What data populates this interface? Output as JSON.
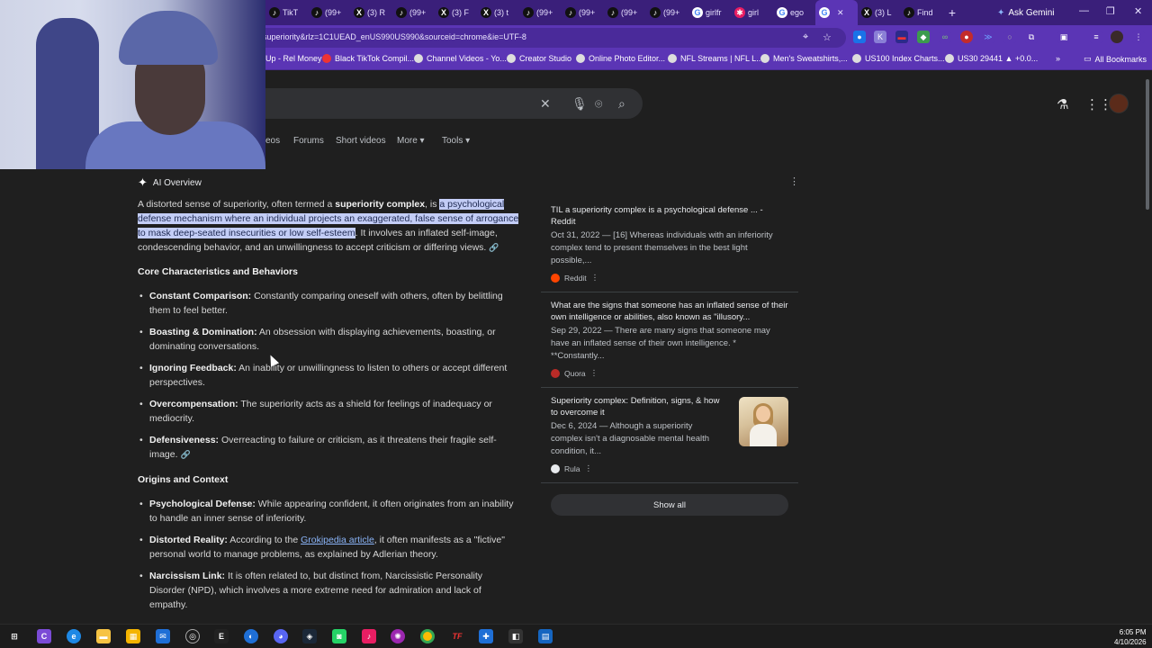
{
  "browser": {
    "tabs": [
      {
        "label": "TikT",
        "icon": "tiktok-icon"
      },
      {
        "label": "(99+",
        "icon": "tiktok-icon"
      },
      {
        "label": "(3) R",
        "icon": "x-icon"
      },
      {
        "label": "(99+",
        "icon": "tiktok-icon"
      },
      {
        "label": "(3) F",
        "icon": "x-icon"
      },
      {
        "label": "(3) t",
        "icon": "x-icon"
      },
      {
        "label": "(99+",
        "icon": "tiktok-icon"
      },
      {
        "label": "(99+",
        "icon": "tiktok-icon"
      },
      {
        "label": "(99+",
        "icon": "tiktok-icon"
      },
      {
        "label": "(99+",
        "icon": "tiktok-icon"
      },
      {
        "label": "girlfr",
        "icon": "google-icon"
      },
      {
        "label": "girl",
        "icon": "pinwheel-icon"
      },
      {
        "label": "ego",
        "icon": "google-icon"
      },
      {
        "label": "",
        "icon": "google-icon",
        "active": true
      },
      {
        "label": "(3) L",
        "icon": "x-icon"
      },
      {
        "label": "Find",
        "icon": "tiktok-icon"
      }
    ],
    "new_tab": "+",
    "gemini_label": "Ask Gemini",
    "url": "superiority&rlz=1C1UEAD_enUS990US990&sourceid=chrome&ie=UTF-8",
    "bookmarks": [
      "Up - Rel Money",
      "Black TikTok Compil...",
      "Channel Videos - Yo...",
      "Creator Studio",
      "Online Photo Editor...",
      "NFL Streams | NFL L...",
      "Men's Sweatshirts,...",
      "US100 Index Charts...",
      "US30 29441 ▲ +0.0..."
    ],
    "bookmarks_overflow": "»",
    "all_bookmarks": "All Bookmarks"
  },
  "search": {
    "filters": [
      "eos",
      "Forums",
      "Short videos",
      "More ▾",
      "Tools ▾"
    ]
  },
  "ai_overview": {
    "heading": "AI Overview",
    "intro_1": "A distorted sense of superiority, often termed a ",
    "intro_bold": "superiority complex",
    "intro_2": ", is ",
    "intro_highlight": "a psychological defense mechanism where an individual projects an exaggerated, false sense of arrogance to mask deep-seated insecurities or low self-esteem",
    "intro_3": ". It involves an inflated self-image, condescending behavior, and an unwillingness to accept criticism or differing views.",
    "section1_title": "Core Characteristics and Behaviors",
    "section1": [
      {
        "term": "Constant Comparison:",
        "text": " Constantly comparing oneself with others, often by belittling them to feel better."
      },
      {
        "term": "Boasting & Domination:",
        "text": " An obsession with displaying achievements, boasting, or dominating conversations."
      },
      {
        "term": "Ignoring Feedback:",
        "text": " An inability or unwillingness to listen to others or accept different perspectives."
      },
      {
        "term": "Overcompensation:",
        "text": " The superiority acts as a shield for feelings of inadequacy or mediocrity."
      },
      {
        "term": "Defensiveness:",
        "text": " Overreacting to failure or criticism, as it threatens their fragile self-image."
      }
    ],
    "section2_title": "Origins and Context",
    "section2": [
      {
        "term": "Psychological Defense:",
        "text": " While appearing confident, it often originates from an inability to handle an inner sense of inferiority."
      },
      {
        "term": "Distorted Reality:",
        "text_before": " According to the ",
        "link": "Grokipedia article",
        "text_after": ", it often manifests as a \"fictive\" personal world to manage problems, as explained by Adlerian theory."
      },
      {
        "term": "Narcissism Link:",
        "text": " It is often related to, but distinct from, Narcissistic Personality Disorder (NPD), which involves a more extreme need for admiration and lack of empathy."
      }
    ]
  },
  "sources": [
    {
      "title": "TIL a superiority complex is a psychological defense ... - Reddit",
      "snippet": "Oct 31, 2022 — [16] Whereas individuals with an inferiority complex tend to present themselves in the best light possible,...",
      "site": "Reddit",
      "color": "#ff4500"
    },
    {
      "title": "What are the signs that someone has an inflated sense of their own intelligence or abilities, also known as \"illusory...",
      "snippet": "Sep 29, 2022 — There are many signs that someone may have an inflated sense of their own intelligence. * **Constantly...",
      "site": "Quora",
      "color": "#b92b27"
    },
    {
      "title": "Superiority complex: Definition, signs, & how to overcome it",
      "snippet": "Dec 6, 2024 — Although a superiority complex isn't a diagnosable mental health condition, it...",
      "site": "Rula",
      "color": "#e8eaed"
    }
  ],
  "show_all": "Show all",
  "taskbar": {
    "time": "6:05 PM",
    "date": "4/10/2026"
  }
}
